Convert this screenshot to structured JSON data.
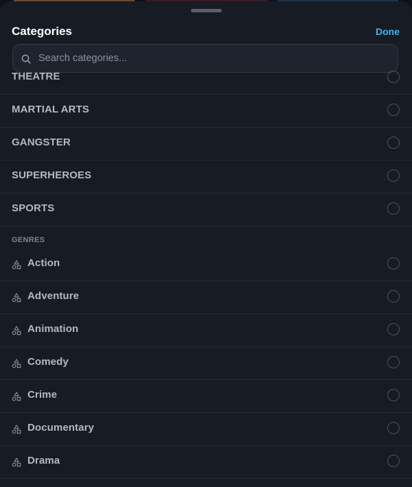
{
  "sheet": {
    "title": "Categories",
    "done_label": "Done",
    "search_placeholder": "Search categories..."
  },
  "categories": [
    {
      "label": "THEATRE",
      "selected": false
    },
    {
      "label": "MARTIAL ARTS",
      "selected": false
    },
    {
      "label": "GANGSTER",
      "selected": false
    },
    {
      "label": "SUPERHEROES",
      "selected": false
    },
    {
      "label": "SPORTS",
      "selected": false
    }
  ],
  "genres_section": {
    "title": "GENRES"
  },
  "genres": [
    {
      "label": "Action",
      "icon": "genre-icon",
      "selected": false
    },
    {
      "label": "Adventure",
      "icon": "genre-icon",
      "selected": false
    },
    {
      "label": "Animation",
      "icon": "genre-icon",
      "selected": false
    },
    {
      "label": "Comedy",
      "icon": "genre-icon",
      "selected": false
    },
    {
      "label": "Crime",
      "icon": "genre-icon",
      "selected": false
    },
    {
      "label": "Documentary",
      "icon": "genre-icon",
      "selected": false
    },
    {
      "label": "Drama",
      "icon": "genre-icon",
      "selected": false
    }
  ],
  "colors": {
    "background": "#171b24",
    "accent": "#37b6f0",
    "text": "#b3b8c1",
    "divider": "#252a33"
  }
}
